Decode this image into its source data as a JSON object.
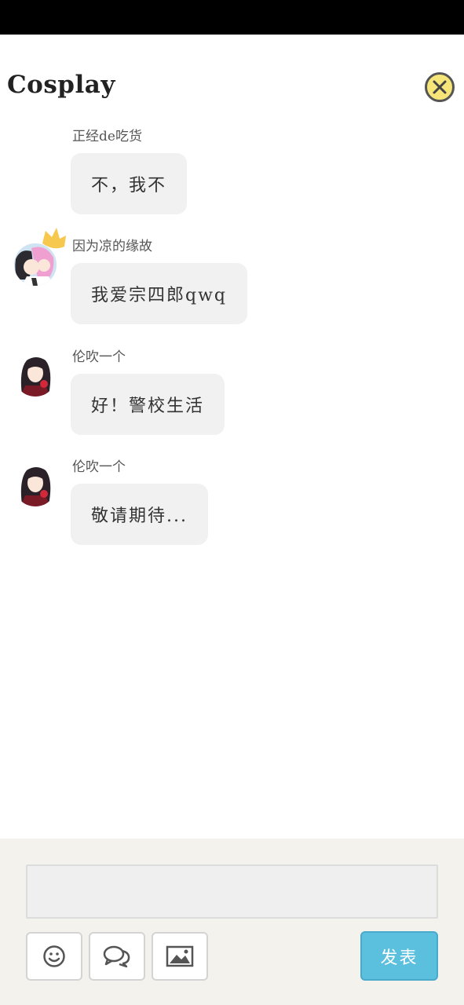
{
  "header": {
    "title": "Cosplay",
    "close_icon": "close-circle-icon"
  },
  "messages": [
    {
      "username": "正经de吃货",
      "text": "不，我不",
      "avatar": "none"
    },
    {
      "username": "因为凉的缘故",
      "text": "我爱宗四郎qwq",
      "avatar": "anime-pink-hair-avatar",
      "badge": "crown-icon"
    },
    {
      "username": "伦吹一个",
      "text": "好！警校生活",
      "avatar": "anime-dark-hair-avatar"
    },
    {
      "username": "伦吹一个",
      "text": "敬请期待...",
      "avatar": "anime-dark-hair-avatar"
    }
  ],
  "composer": {
    "input_value": "",
    "emoji_icon": "smiley-icon",
    "chat_icon": "chat-bubbles-icon",
    "image_icon": "image-icon",
    "send_label": "发表"
  },
  "colors": {
    "status_bar": "#000000",
    "close_fill": "#f6e579",
    "bubble": "#f1f1f1",
    "footer": "#f3f2ec",
    "send_button": "#5bbfde"
  }
}
